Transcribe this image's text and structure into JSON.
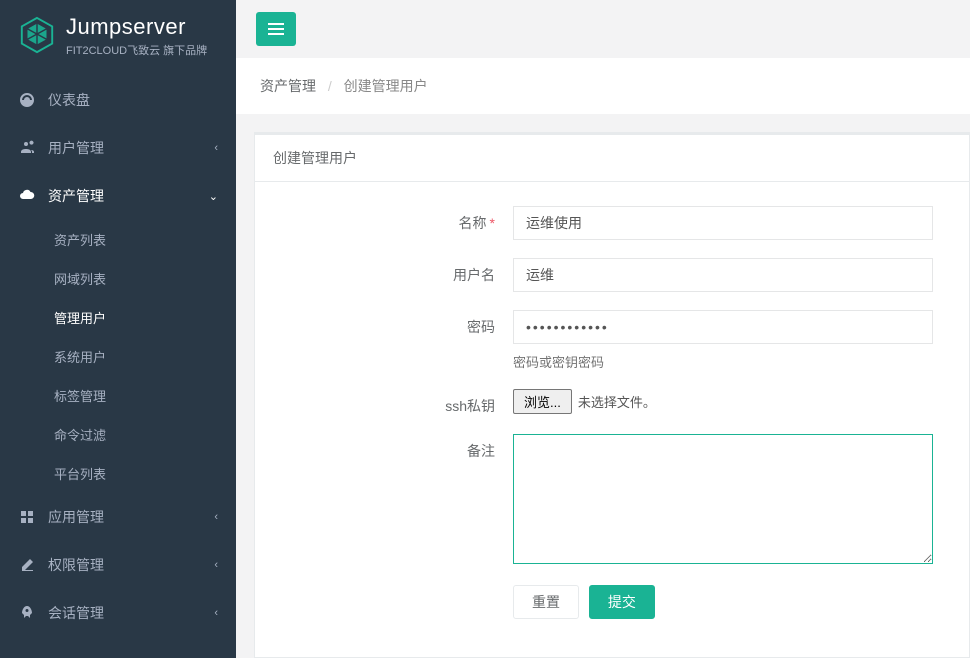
{
  "brand": {
    "title": "Jumpserver",
    "subtitle": "FIT2CLOUD飞致云 旗下品牌"
  },
  "sidebar": {
    "items": [
      {
        "label": "仪表盘"
      },
      {
        "label": "用户管理"
      },
      {
        "label": "资产管理"
      },
      {
        "label": "应用管理"
      },
      {
        "label": "权限管理"
      },
      {
        "label": "会话管理"
      }
    ],
    "assets_sub": [
      {
        "label": "资产列表"
      },
      {
        "label": "网域列表"
      },
      {
        "label": "管理用户"
      },
      {
        "label": "系统用户"
      },
      {
        "label": "标签管理"
      },
      {
        "label": "命令过滤"
      },
      {
        "label": "平台列表"
      }
    ]
  },
  "breadcrumb": {
    "root": "资产管理",
    "current": "创建管理用户"
  },
  "panel": {
    "title": "创建管理用户"
  },
  "form": {
    "labels": {
      "name": "名称",
      "username": "用户名",
      "password": "密码",
      "ssh_key": "ssh私钥",
      "comment": "备注"
    },
    "values": {
      "name": "运维使用",
      "username": "运维",
      "password": "************",
      "comment": ""
    },
    "help": {
      "password": "密码或密钥密码"
    },
    "file": {
      "button": "浏览...",
      "status": "未选择文件。"
    },
    "buttons": {
      "reset": "重置",
      "submit": "提交"
    }
  }
}
